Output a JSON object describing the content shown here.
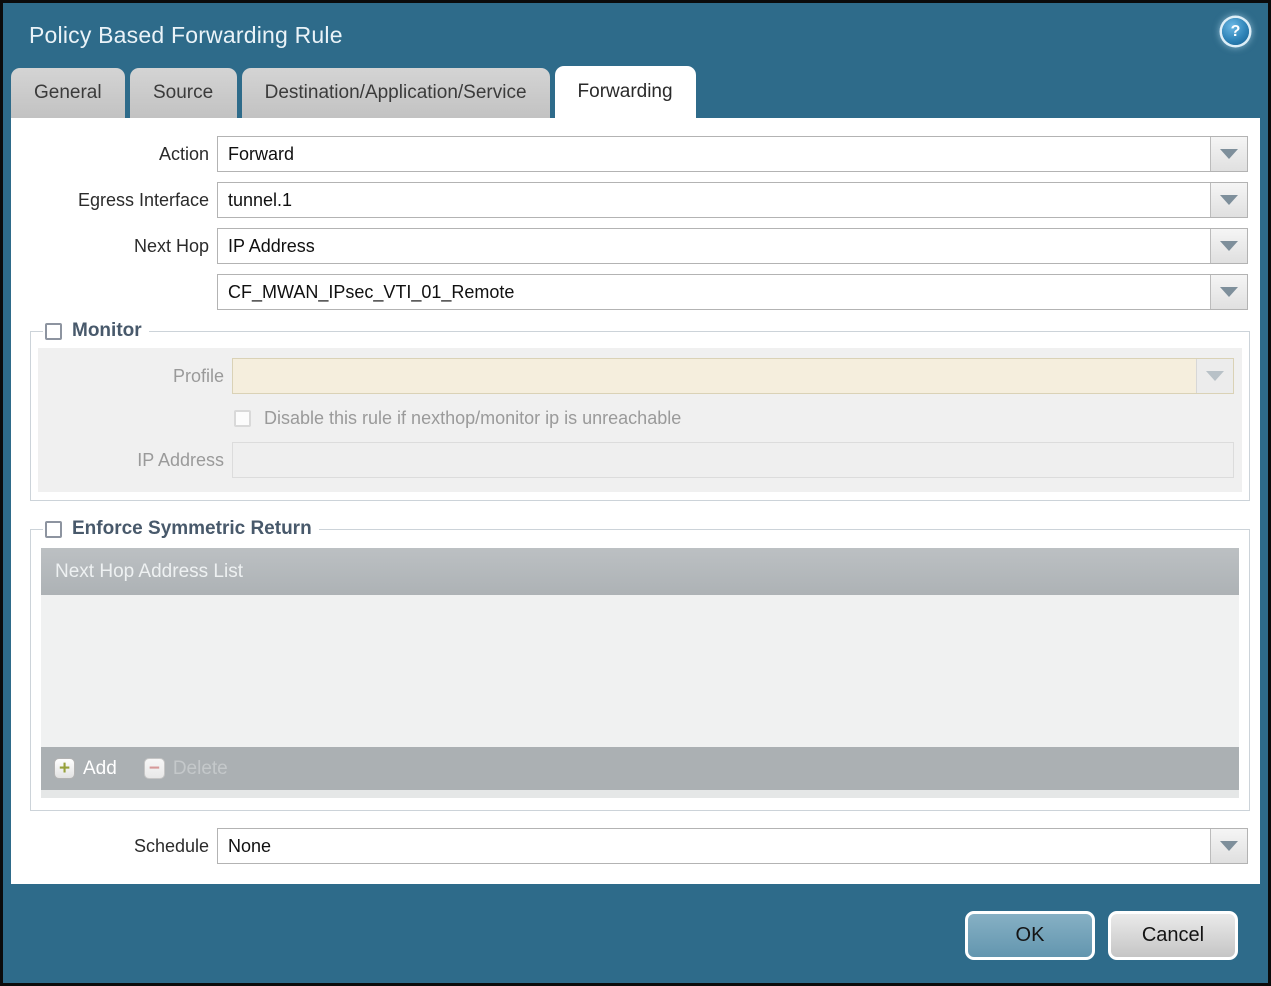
{
  "dialog": {
    "title": "Policy Based Forwarding Rule"
  },
  "tabs": [
    {
      "label": "General",
      "active": false
    },
    {
      "label": "Source",
      "active": false
    },
    {
      "label": "Destination/Application/Service",
      "active": false
    },
    {
      "label": "Forwarding",
      "active": true
    }
  ],
  "form": {
    "action": {
      "label": "Action",
      "value": "Forward"
    },
    "egress_interface": {
      "label": "Egress Interface",
      "value": "tunnel.1"
    },
    "next_hop": {
      "label": "Next Hop",
      "value": "IP Address"
    },
    "next_hop_address": {
      "value": "CF_MWAN_IPsec_VTI_01_Remote"
    },
    "schedule": {
      "label": "Schedule",
      "value": "None"
    }
  },
  "monitor": {
    "legend": "Monitor",
    "checked": false,
    "profile": {
      "label": "Profile",
      "value": ""
    },
    "disable_rule": {
      "label": "Disable this rule if nexthop/monitor ip is unreachable",
      "checked": false
    },
    "ip_address": {
      "label": "IP Address",
      "value": ""
    }
  },
  "symmetric_return": {
    "legend": "Enforce Symmetric Return",
    "checked": false,
    "table": {
      "header": "Next Hop Address List",
      "rows": []
    },
    "add_label": "Add",
    "delete_label": "Delete"
  },
  "footer": {
    "ok_label": "OK",
    "cancel_label": "Cancel"
  },
  "icons": {
    "help": "question-mark-circle",
    "dropdown": "chevron-down-triangle",
    "add": "plus",
    "delete": "minus"
  },
  "colors": {
    "chrome_teal": "#2e6b8a",
    "active_tab": "#ffffff",
    "inactive_tab": "#c9c9c9",
    "disabled_field_beige": "#f5eedd",
    "table_header_gray": "#b3b8bb",
    "ok_button": "#6e9fb8",
    "cancel_button": "#d6d6d6",
    "legend_text": "#48596b"
  }
}
